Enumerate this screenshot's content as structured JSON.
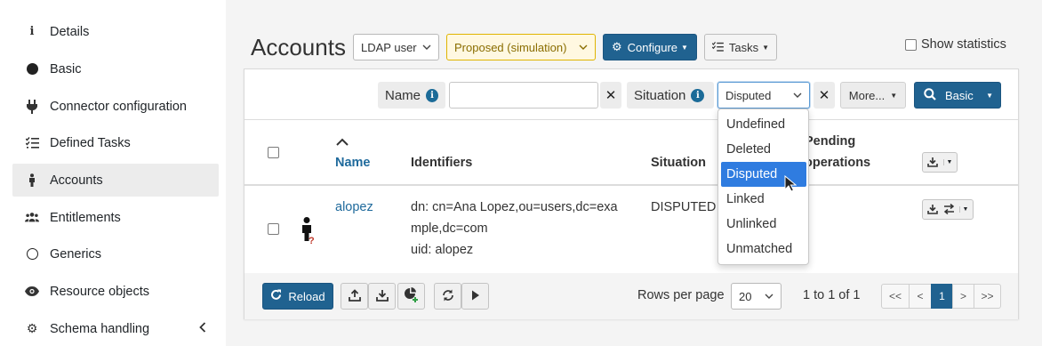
{
  "sidebar": {
    "items": [
      {
        "label": "Details",
        "icon": "info-icon"
      },
      {
        "label": "Basic",
        "icon": "circle-filled-icon"
      },
      {
        "label": "Connector configuration",
        "icon": "plug-icon"
      },
      {
        "label": "Defined Tasks",
        "icon": "task-list-icon"
      },
      {
        "label": "Accounts",
        "icon": "person-icon",
        "active": true
      },
      {
        "label": "Entitlements",
        "icon": "users-icon"
      },
      {
        "label": "Generics",
        "icon": "circle-outline-icon"
      },
      {
        "label": "Resource objects",
        "icon": "eye-icon"
      },
      {
        "label": "Schema handling",
        "icon": "cogs-icon"
      }
    ]
  },
  "header": {
    "title": "Accounts",
    "kind_select": "LDAP user",
    "lifecycle_select": "Proposed (simulation)",
    "configure_label": "Configure",
    "tasks_label": "Tasks",
    "show_statistics": "Show statistics"
  },
  "filters": {
    "name_label": "Name",
    "name_value": "",
    "situation_label": "Situation",
    "situation_value": "Disputed",
    "more_label": "More...",
    "search_mode": "Basic"
  },
  "dropdown": {
    "options": [
      "Undefined",
      "Deleted",
      "Disputed",
      "Linked",
      "Unlinked",
      "Unmatched"
    ],
    "selected": "Disputed"
  },
  "table": {
    "columns": {
      "name": "Name",
      "identifiers": "Identifiers",
      "situation": "Situation",
      "pending_1": "Pending",
      "pending_2": "operations"
    },
    "rows": [
      {
        "name": "alopez",
        "identifiers_line1": "dn: cn=Ana Lopez,ou=users,dc=exa",
        "identifiers_line2": "mple,dc=com",
        "identifiers_line3": "uid: alopez",
        "situation": "DISPUTED"
      }
    ]
  },
  "footer": {
    "reload_label": "Reload",
    "rows_per_page_label": "Rows per page",
    "rows_per_page_value": "20",
    "range_text": "1 to 1 of 1",
    "pagination": [
      "<<",
      "<",
      "1",
      ">",
      ">>"
    ],
    "current_page": "1"
  },
  "colors": {
    "primary": "#206290",
    "warning_border": "#e0b400",
    "warning_bg": "#fff8e1",
    "selected_option": "#2f7ce0"
  }
}
